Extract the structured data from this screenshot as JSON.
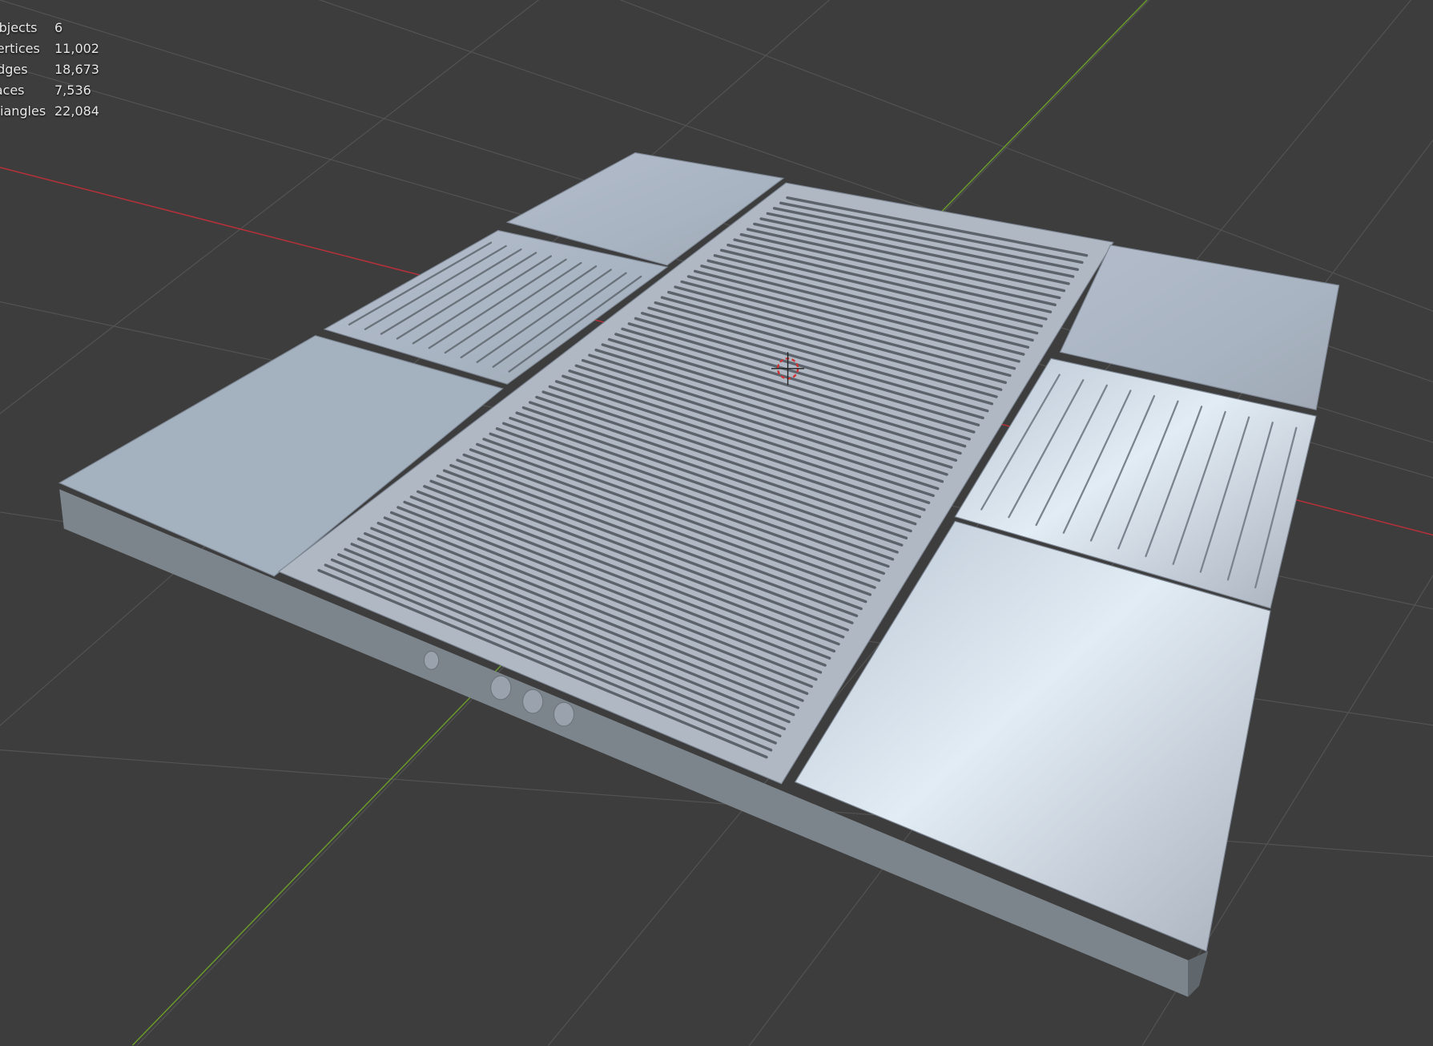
{
  "viewport": {
    "background_color": "#3d3d3d",
    "x_axis_color": "#b8313a",
    "y_axis_color": "#6a9a2a",
    "grid_color": "#545454",
    "model_color": "#aab4c0"
  },
  "stats": [
    {
      "label": "Objects",
      "value": "6"
    },
    {
      "label": "Vertices",
      "value": "11,002"
    },
    {
      "label": "Edges",
      "value": "18,673"
    },
    {
      "label": "Faces",
      "value": "7,536"
    },
    {
      "label": "Triangles",
      "value": "22,084"
    }
  ],
  "icons": {
    "cursor": "3d-cursor-icon"
  }
}
